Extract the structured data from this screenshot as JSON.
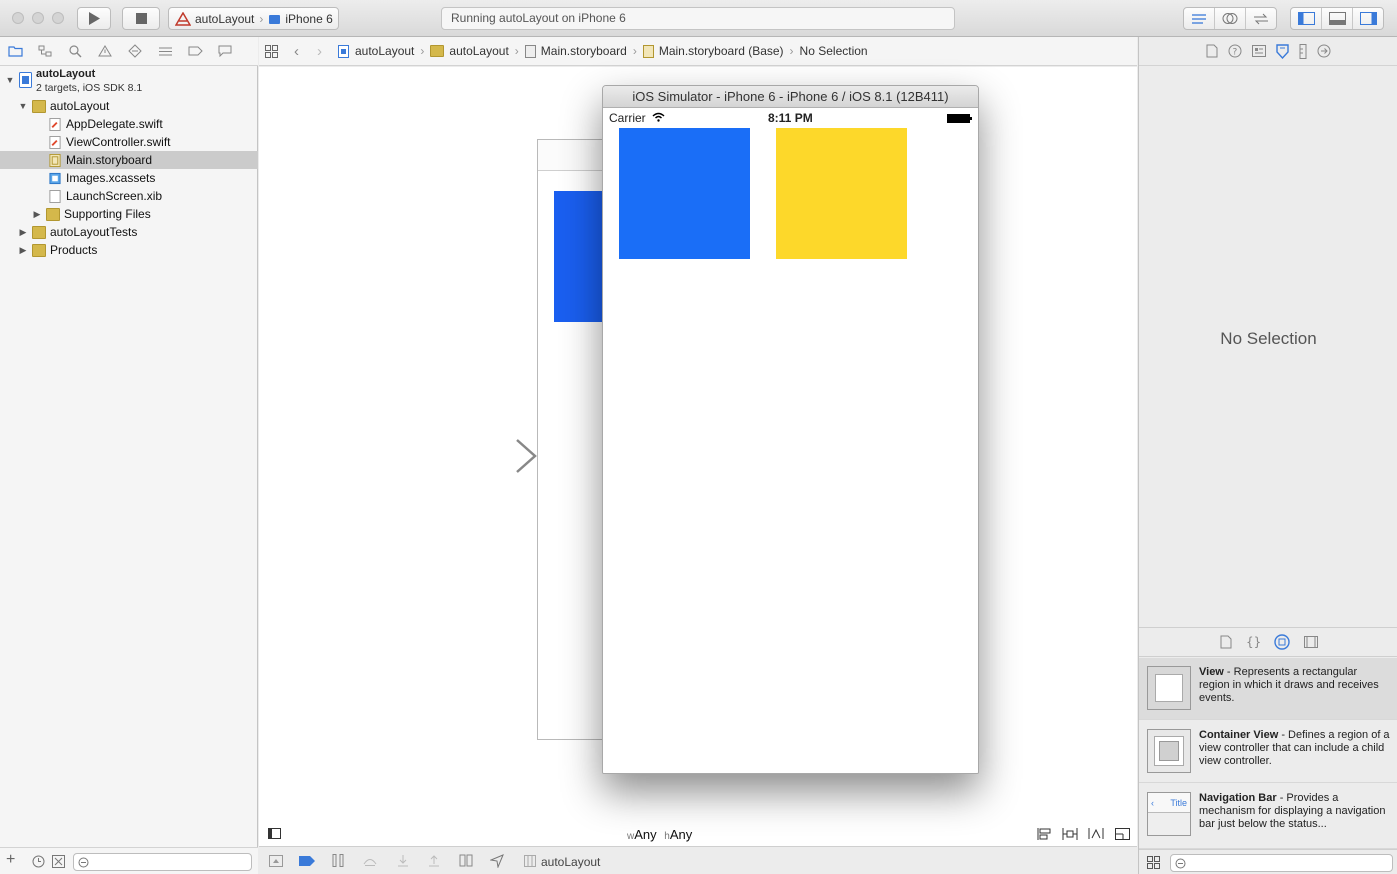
{
  "toolbar": {
    "scheme_project": "autoLayout",
    "scheme_device": "iPhone 6",
    "activity_status": "Running autoLayout on iPhone 6"
  },
  "navigator": {
    "project_name": "autoLayout",
    "project_subtitle": "2 targets, iOS SDK 8.1",
    "items": [
      {
        "label": "autoLayout",
        "type": "folder",
        "expanded": true
      },
      {
        "label": "AppDelegate.swift",
        "type": "swift"
      },
      {
        "label": "ViewController.swift",
        "type": "swift"
      },
      {
        "label": "Main.storyboard",
        "type": "storyboard",
        "selected": true
      },
      {
        "label": "Images.xcassets",
        "type": "xcassets"
      },
      {
        "label": "LaunchScreen.xib",
        "type": "xib"
      },
      {
        "label": "Supporting Files",
        "type": "folder",
        "expanded": false
      },
      {
        "label": "autoLayoutTests",
        "type": "folder",
        "expanded": false
      },
      {
        "label": "Products",
        "type": "folder",
        "expanded": false
      }
    ]
  },
  "jumpbar": {
    "crumbs": [
      "autoLayout",
      "autoLayout",
      "Main.storyboard",
      "Main.storyboard (Base)",
      "No Selection"
    ]
  },
  "canvas": {
    "size_class_w_prefix": "w",
    "size_class_w": "Any",
    "size_class_h_prefix": "h",
    "size_class_h": "Any"
  },
  "simulator": {
    "title": "iOS Simulator - iPhone 6 - iPhone 6 / iOS 8.1 (12B411)",
    "carrier": "Carrier",
    "time": "8:11 PM",
    "blue_color": "#1a6ef7",
    "yellow_color": "#fdd82a"
  },
  "editor_footer": {
    "target_label": "autoLayout"
  },
  "inspector": {
    "no_selection": "No Selection",
    "library": [
      {
        "title": "View",
        "desc": " - Represents a rectangular region in which it draws and receives events."
      },
      {
        "title": "Container View",
        "desc": " - Defines a region of a view controller that can include a child view controller."
      },
      {
        "title": "Navigation Bar",
        "desc": " - Provides a mechanism for displaying a navigation bar just below the status..."
      }
    ],
    "nav_bar_thumb_label": "Title"
  },
  "colors": {
    "accent": "#1a6ef7",
    "folder": "#d4b84b"
  }
}
